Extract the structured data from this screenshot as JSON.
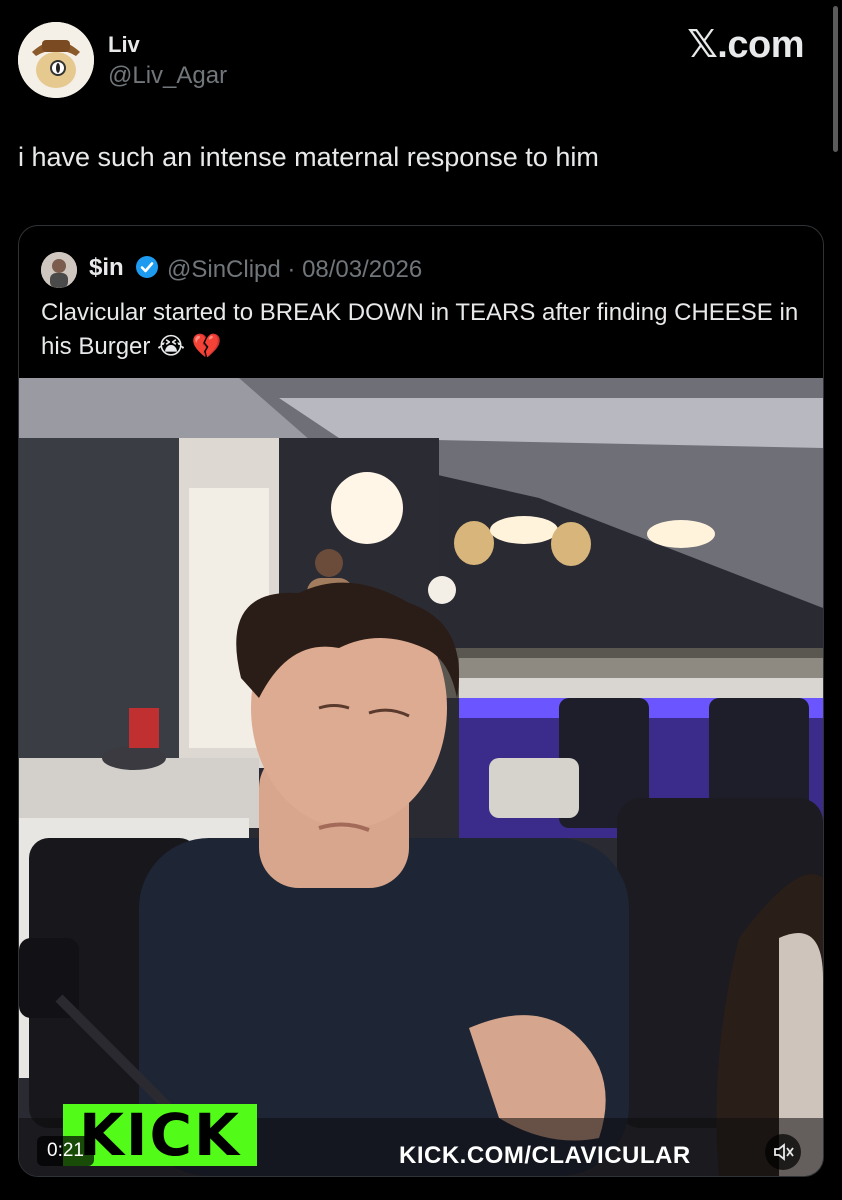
{
  "header": {
    "author_name": "Liv",
    "author_handle": "@Liv_Agar",
    "brand": "𝕏.com"
  },
  "tweet": {
    "text": "i have such an intense maternal response to him"
  },
  "quote": {
    "name": "$in",
    "handle_date": "@SinClipd · 08/03/2026",
    "text": "Clavicular started to BREAK DOWN in TEARS after finding CHEESE in his Burger 😭 💔"
  },
  "video": {
    "timestamp": "0:21",
    "kick_logo": "KICK",
    "kick_url": "KICK.COM/CLAVICULAR",
    "accent_color": "#53fc18"
  },
  "icons": {
    "verified": "verified-badge-icon",
    "mute": "mute-icon"
  }
}
